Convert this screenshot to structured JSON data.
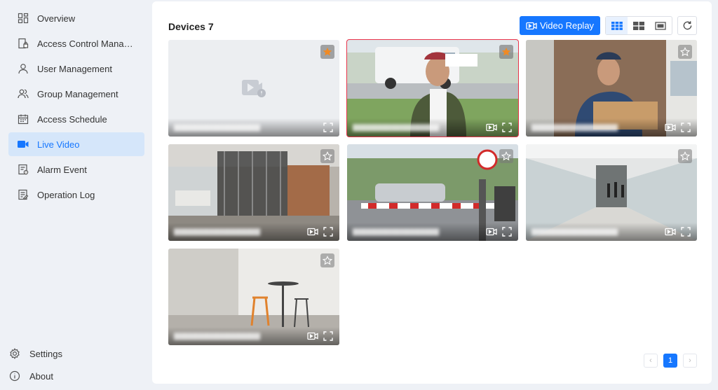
{
  "sidebar": {
    "items": [
      {
        "label": "Overview",
        "icon": "dashboard-icon",
        "active": false
      },
      {
        "label": "Access Control Manag...",
        "icon": "door-lock-icon",
        "active": false
      },
      {
        "label": "User Management",
        "icon": "user-icon",
        "active": false
      },
      {
        "label": "Group Management",
        "icon": "group-icon",
        "active": false
      },
      {
        "label": "Access Schedule",
        "icon": "calendar-icon",
        "active": false
      },
      {
        "label": "Live Video",
        "icon": "video-camera-icon",
        "active": true
      },
      {
        "label": "Alarm Event",
        "icon": "alarm-event-icon",
        "active": false
      },
      {
        "label": "Operation Log",
        "icon": "log-icon",
        "active": false
      }
    ],
    "settings_label": "Settings",
    "about_label": "About"
  },
  "main": {
    "title": "Devices 7",
    "video_replay_label": "Video Replay",
    "layouts": [
      "grid-3x3-icon",
      "grid-2x2-icon",
      "single-view-icon"
    ],
    "active_layout": "grid-3x3-icon"
  },
  "tiles": [
    {
      "favorite": true,
      "selected": false,
      "offline": true
    },
    {
      "favorite": true,
      "selected": true,
      "offline": false
    },
    {
      "favorite": false,
      "selected": false,
      "offline": false
    },
    {
      "favorite": false,
      "selected": false,
      "offline": false
    },
    {
      "favorite": false,
      "selected": false,
      "offline": false
    },
    {
      "favorite": false,
      "selected": false,
      "offline": false
    },
    {
      "favorite": false,
      "selected": false,
      "offline": false
    }
  ],
  "pagination": {
    "current_page": "1"
  },
  "colors": {
    "accent": "#1677ff",
    "selected_border": "#e8334a",
    "favorite_star": "#f08a24",
    "sidebar_bg": "#eef1f6"
  }
}
